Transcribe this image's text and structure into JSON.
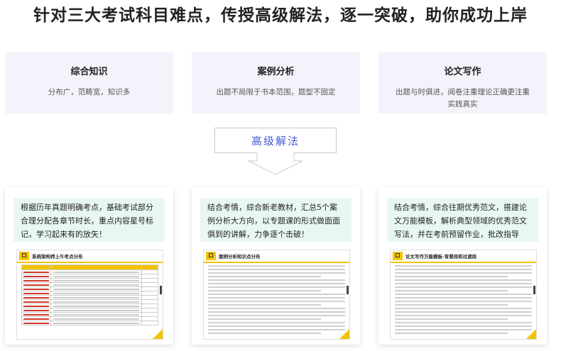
{
  "headline": "针对三大考试科目难点，传授高级解法，逐一突破，助你成功上岸",
  "subjects": [
    {
      "title": "综合知识",
      "desc": "分布广，范畴宽，知识多"
    },
    {
      "title": "案例分析",
      "desc": "出题不局限于书本范围，题型不固定"
    },
    {
      "title": "论文写作",
      "desc": "出题与时俱进，阅卷注重理论正确更注重实践真实"
    }
  ],
  "method_label": "高级解法",
  "methods": [
    {
      "text": "根据历年真题明确考点，基础考试部分合理分配各章节时长，重点内容星号标记，学习起来有的放矢！",
      "doc_title": "系统架构师上午考点分布"
    },
    {
      "text": "结合考情，综合新老教材，汇总5个案例分析大方向，以专题课的形式做面面俱到的讲解，力争逐个击破！",
      "doc_title": "案例分析知识点分布"
    },
    {
      "text": "结合考情，综合往期优秀范文，搭建论文万能模板，解析典型领域的优秀范文写法，并在考前预留作业，批改指导",
      "doc_title": "论文写作万能模板-背景段和过渡段"
    }
  ],
  "colors": {
    "accent": "#4a5bd0",
    "highlight": "#f4c300",
    "note_bg": "#e9f7f3",
    "card_bg": "#f3f4fb"
  },
  "icons": [
    "down-arrow-icon",
    "document-logo-icon"
  ]
}
